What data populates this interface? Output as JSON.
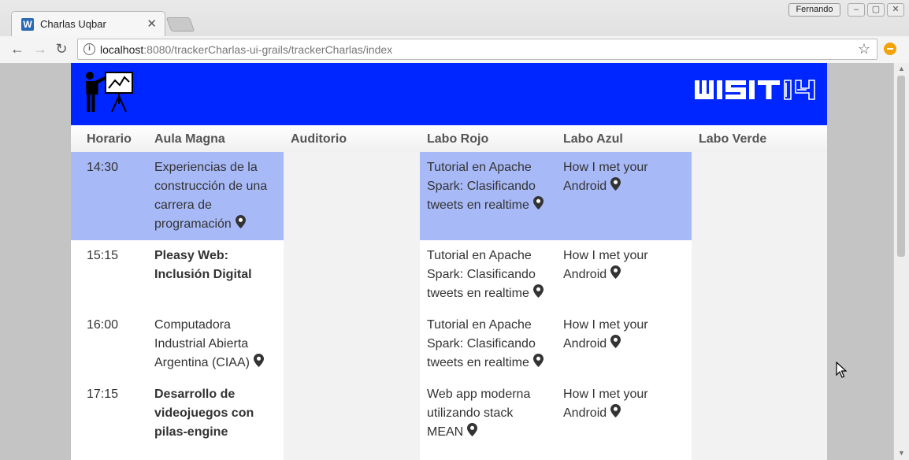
{
  "browser": {
    "tab_title": "Charlas Uqbar",
    "tab_favicon": "W",
    "profile_name": "Fernando",
    "url_host": "localhost",
    "url_rest": ":8080/trackerCharlas-ui-grails/trackerCharlas/index"
  },
  "banner": {
    "logo_text": "WISIT14"
  },
  "table": {
    "headers": [
      "Horario",
      "Aula Magna",
      "Auditorio",
      "Labo Rojo",
      "Labo Azul",
      "Labo Verde"
    ],
    "rows": [
      {
        "time": "14:30",
        "aula_magna": [
          "Experiencias de la",
          "construcción de una",
          "carrera de",
          "programación"
        ],
        "labo_rojo": [
          "Tutorial en Apache",
          "Spark: Clasificando",
          "tweets en realtime"
        ],
        "labo_azul": [
          "How I met your",
          "Android"
        ]
      },
      {
        "time": "15:15",
        "aula_magna": [
          "Pleasy Web:",
          "Inclusión Digital"
        ],
        "labo_rojo": [
          "Tutorial en Apache",
          "Spark: Clasificando",
          "tweets en realtime"
        ],
        "labo_azul": [
          "How I met your",
          "Android"
        ]
      },
      {
        "time": "16:00",
        "aula_magna": [
          "Computadora",
          "Industrial Abierta",
          "Argentina (CIAA)"
        ],
        "labo_rojo": [
          "Tutorial en Apache",
          "Spark: Clasificando",
          "tweets en realtime"
        ],
        "labo_azul": [
          "How I met your",
          "Android"
        ]
      },
      {
        "time": "17:15",
        "aula_magna": [
          "Desarrollo de",
          "videojuegos con",
          "pilas-engine"
        ],
        "labo_rojo": [
          "Web app moderna",
          "utilizando stack",
          "MEAN"
        ],
        "labo_azul": [
          "How I met your",
          "Android"
        ]
      }
    ]
  },
  "colors": {
    "banner": "#0026ff",
    "highlight_row": "#a8b9f7",
    "column_white": "#ffffff",
    "column_gray": "#f2f2f2"
  }
}
